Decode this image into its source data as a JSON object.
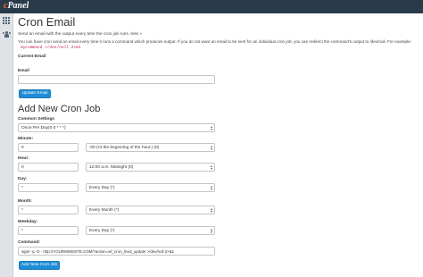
{
  "header": {
    "logo_prefix": "c",
    "logo_rest": "Panel"
  },
  "cron_email": {
    "title": "Cron Email",
    "intro": "Send an email with the output every time the cron job runs. less »",
    "help": "You can have cron send an email every time it runs a command which produces output. If you do not want an email to be sent for an individual cron job, you can redirect the command's output to /dev/null. For example:",
    "example": "mycommand >/dev/null 2>&1",
    "current_email_label": "Current Email",
    "current_email_value": "",
    "email_label": "Email",
    "email_value": "",
    "update_button": "Update Email"
  },
  "add_cron": {
    "title": "Add New Cron Job",
    "common_label": "Common Settings",
    "common_value": "Once Per Day(0 0 * * *)",
    "minute_label": "Minute:",
    "minute_value": "0",
    "minute_select": ":00 (At the beginning of the hour.) (0)",
    "hour_label": "Hour:",
    "hour_value": "0",
    "hour_select": "12:00 a.m. Midnight (0)",
    "day_label": "Day:",
    "day_value": "*",
    "day_select": "Every Day (*)",
    "month_label": "Month:",
    "month_value": "*",
    "month_select": "Every Month (*)",
    "weekday_label": "Weekday:",
    "weekday_value": "*",
    "weekday_select": "Every Day (*)",
    "command_label": "Command:",
    "command_value": "wget -q -O - http://YOURWEBSITE.COM/?action=wf_cron_feed_update >/dev/null 2>&1",
    "add_button": "Add New Cron Job"
  }
}
